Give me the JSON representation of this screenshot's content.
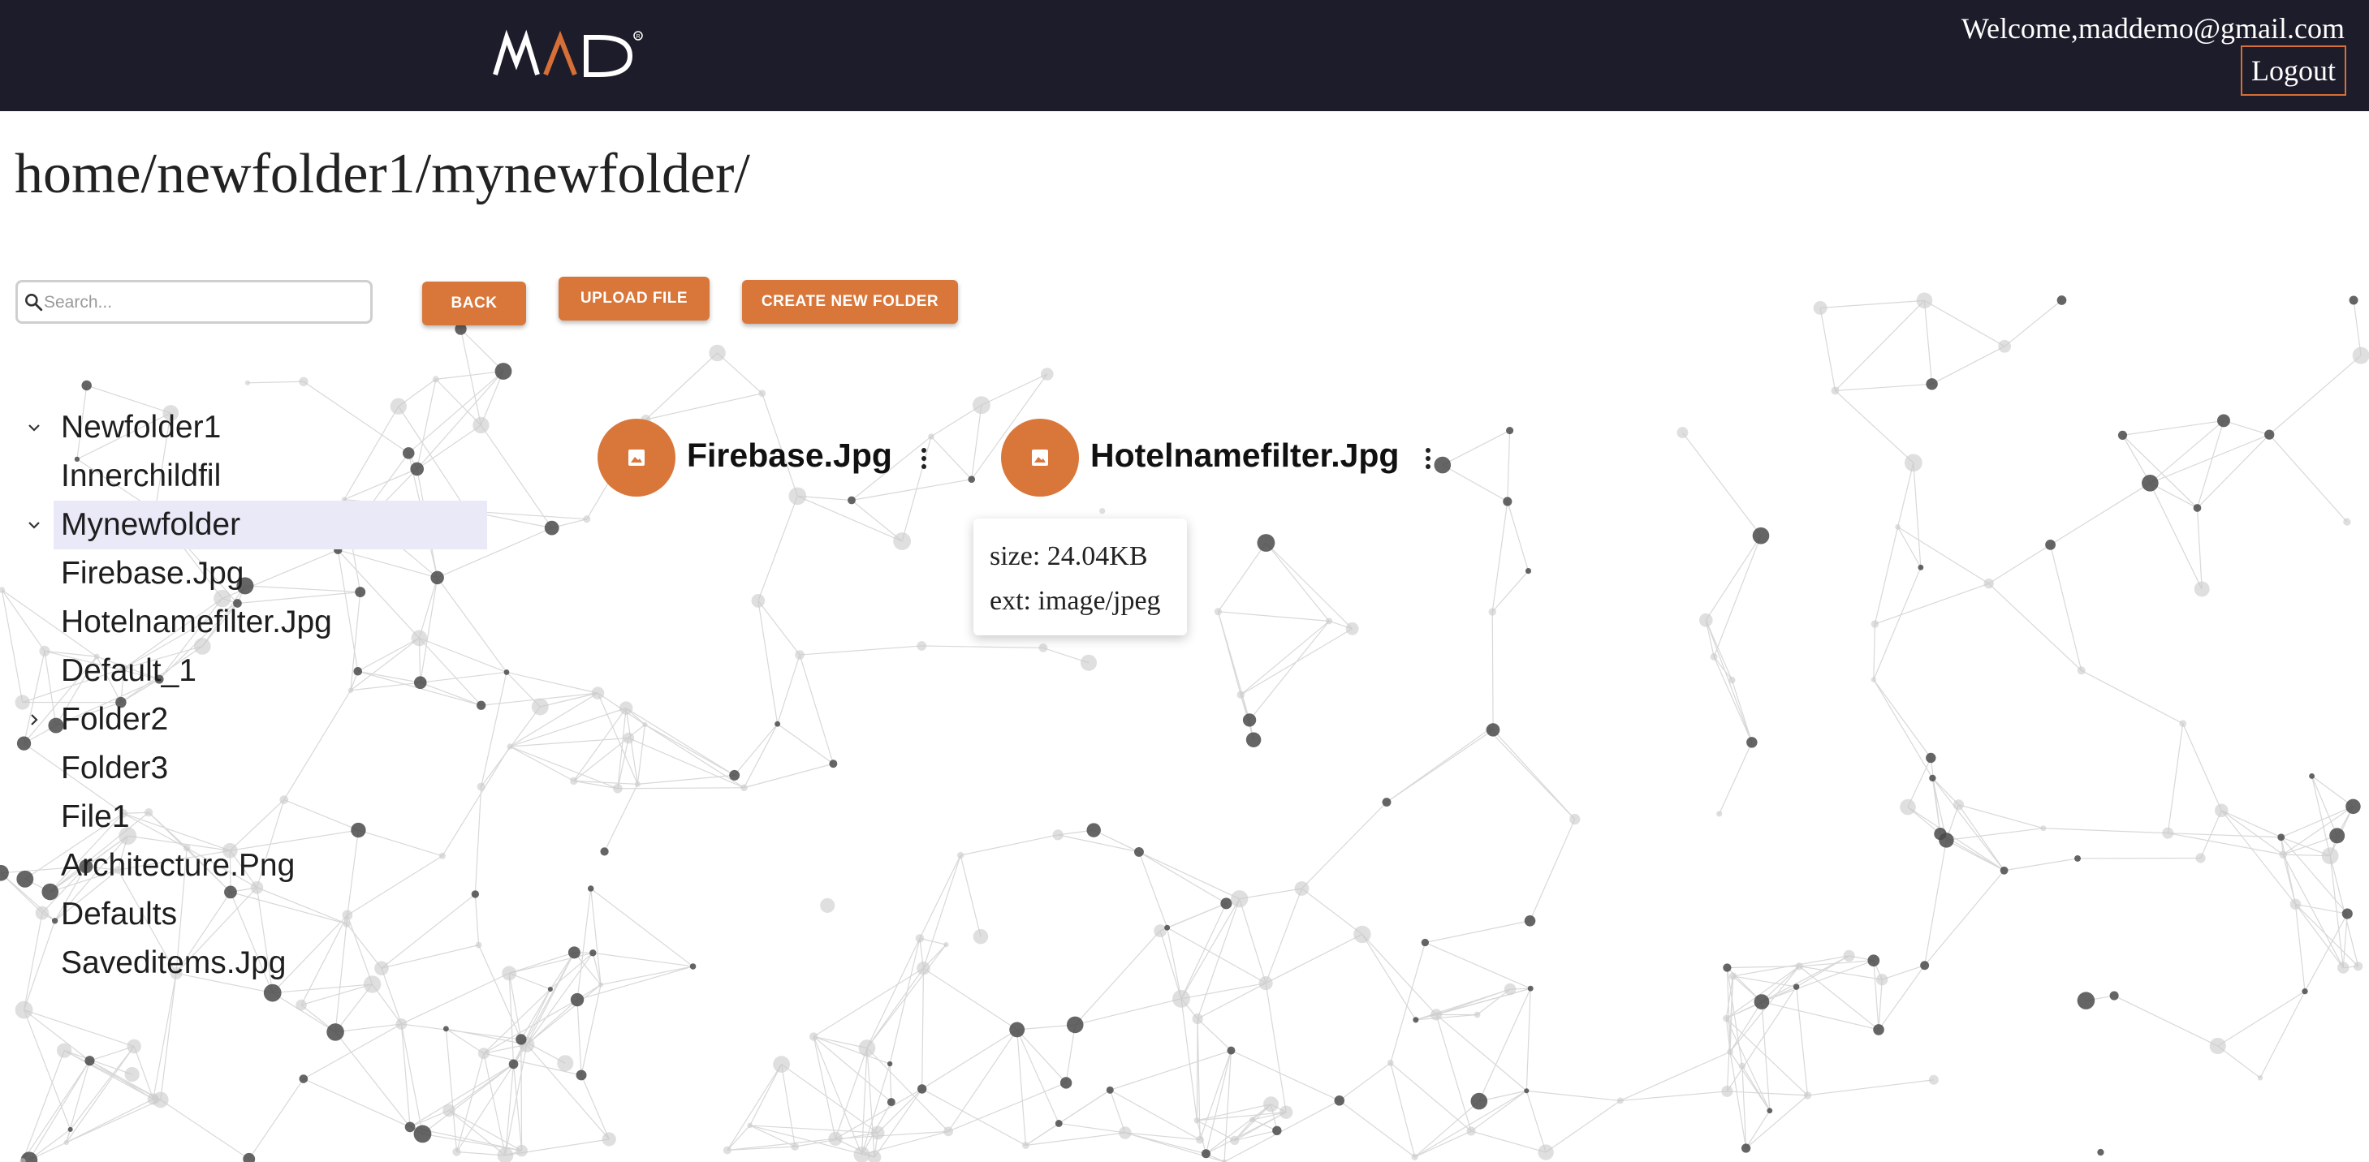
{
  "header": {
    "logo_text": "MAD",
    "welcome": "Welcome,maddemo@gmail.com",
    "logout_label": "Logout"
  },
  "breadcrumb": "home/newfolder1/mynewfolder/",
  "search": {
    "placeholder": "Search...",
    "value": ""
  },
  "toolbar": {
    "back_label": "BACK",
    "upload_label": "UPLOAD FILE",
    "create_folder_label": "CREATE NEW FOLDER"
  },
  "tree": [
    {
      "label": "Newfolder1",
      "chevron": "down"
    },
    {
      "label": "Innerchildfil",
      "chevron": "none"
    },
    {
      "label": "Mynewfolder",
      "chevron": "down",
      "selected": true
    },
    {
      "label": "Firebase.Jpg",
      "chevron": "none"
    },
    {
      "label": "Hotelnamefilter.Jpg",
      "chevron": "none"
    },
    {
      "label": "Default_1",
      "chevron": "none"
    },
    {
      "label": "Folder2",
      "chevron": "right"
    },
    {
      "label": "Folder3",
      "chevron": "none"
    },
    {
      "label": "File1",
      "chevron": "none"
    },
    {
      "label": "Architecture.Png",
      "chevron": "none"
    },
    {
      "label": "Defaults",
      "chevron": "none"
    },
    {
      "label": "Saveditems.Jpg",
      "chevron": "none"
    }
  ],
  "files": [
    {
      "name": "Firebase.Jpg",
      "icon": "image-icon"
    },
    {
      "name": "Hotelnamefilter.Jpg",
      "icon": "image-icon"
    }
  ],
  "tooltip": {
    "size": "size: 24.04KB",
    "ext": "ext: image/jpeg"
  },
  "colors": {
    "header_bg": "#1c1c2a",
    "accent": "#d9773b",
    "selected_bg": "#e9e9f7"
  }
}
